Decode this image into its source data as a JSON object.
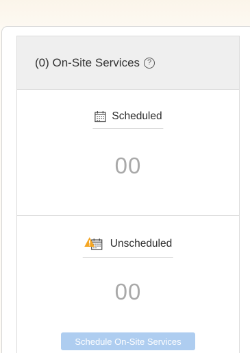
{
  "panel": {
    "title": "(0) On-Site Services",
    "help_icon": "help-circle-icon"
  },
  "scheduled": {
    "label": "Scheduled",
    "count": "00",
    "icon": "calendar-icon"
  },
  "unscheduled": {
    "label": "Unscheduled",
    "count": "00",
    "icon": "calendar-warning-icon",
    "button_label": "Schedule On-Site Services"
  },
  "colors": {
    "accent_button": "#aecdf0",
    "warning": "#f5a623",
    "count_text": "#a9a9a9"
  }
}
